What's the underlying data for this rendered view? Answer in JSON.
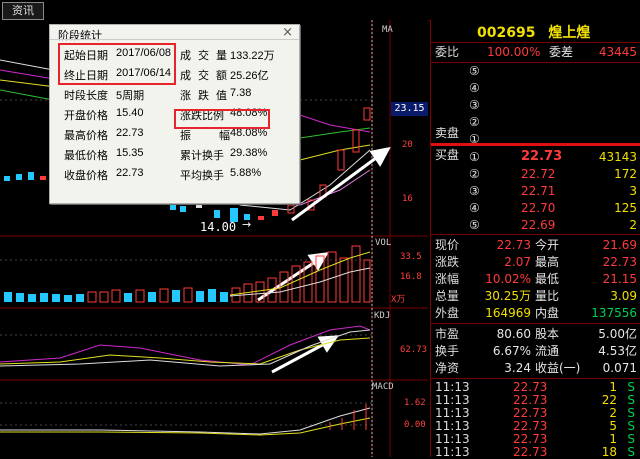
{
  "tabs": {
    "news": "资讯"
  },
  "chart": {
    "main_label": "MA",
    "price_low_annot": "14.00",
    "y_axis": [
      "20",
      "16"
    ],
    "price_tag": "23.15",
    "vol_label": "VOL",
    "vol_axis": [
      "33.5",
      "16.8"
    ],
    "vol_unit": "X万",
    "kdj_label": "KDJ",
    "kdj_axis": [
      "62.73"
    ],
    "macd_label": "MACD",
    "macd_axis": [
      "1.62",
      "0.00"
    ]
  },
  "dialog": {
    "title": "阶段统计",
    "close": "×",
    "left": [
      {
        "k": "起始日期",
        "v": "2017/06/08"
      },
      {
        "k": "终止日期",
        "v": "2017/06/14"
      },
      {
        "k": "时段长度",
        "v": "5周期"
      },
      {
        "k": "开盘价格",
        "v": "15.40"
      },
      {
        "k": "最高价格",
        "v": "22.73"
      },
      {
        "k": "最低价格",
        "v": "15.35"
      },
      {
        "k": "收盘价格",
        "v": "22.73"
      }
    ],
    "right": [
      {
        "k": "成  交  量",
        "v": "133.22万"
      },
      {
        "k": "成  交  额",
        "v": "25.26亿"
      },
      {
        "k": "涨  跌  值",
        "v": "7.38"
      },
      {
        "k": "涨跌比例",
        "v": "48.08%"
      },
      {
        "k": "振        幅",
        "v": "48.08%"
      },
      {
        "k": "累计换手",
        "v": "29.38%"
      },
      {
        "k": "平均换手",
        "v": "5.88%"
      }
    ]
  },
  "quote": {
    "code": "002695",
    "name": "煌上煌",
    "weibi_label": "委比",
    "weibi_value": "100.00%",
    "weicha_label": "委差",
    "weicha_value": "43445",
    "sell_label": "卖盘",
    "buy_label": "买盘",
    "sell_levels": [
      "⑤",
      "④",
      "③",
      "②",
      "①"
    ],
    "buy": [
      {
        "lvl": "①",
        "price": "22.73",
        "vol": "43143"
      },
      {
        "lvl": "②",
        "price": "22.72",
        "vol": "172"
      },
      {
        "lvl": "③",
        "price": "22.71",
        "vol": "3"
      },
      {
        "lvl": "④",
        "price": "22.70",
        "vol": "125"
      },
      {
        "lvl": "⑤",
        "price": "22.69",
        "vol": "2"
      }
    ],
    "stats": [
      {
        "l1": "现价",
        "v1": "22.73",
        "l2": "今开",
        "v2": "21.69"
      },
      {
        "l1": "涨跌",
        "v1": "2.07",
        "l2": "最高",
        "v2": "22.73"
      },
      {
        "l1": "涨幅",
        "v1": "10.02%",
        "l2": "最低",
        "v2": "21.15"
      },
      {
        "l1": "总量",
        "v1": "30.25万",
        "l2": "量比",
        "v2": "3.09"
      },
      {
        "l1": "外盘",
        "v1": "164969",
        "l2": "内盘",
        "v2": "137556"
      }
    ],
    "stats2": [
      {
        "l1": "市盈",
        "v1": "80.60",
        "l2": "股本",
        "v2": "5.00亿"
      },
      {
        "l1": "换手",
        "v1": "6.67%",
        "l2": "流通",
        "v2": "4.53亿"
      },
      {
        "l1": "净资",
        "v1": "3.24",
        "l2": "收益(一)",
        "v2": "0.071"
      }
    ],
    "ticks": [
      {
        "t": "11:13",
        "p": "22.73",
        "v": "1",
        "d": "S"
      },
      {
        "t": "11:13",
        "p": "22.73",
        "v": "22",
        "d": "S"
      },
      {
        "t": "11:13",
        "p": "22.73",
        "v": "2",
        "d": "S"
      },
      {
        "t": "11:13",
        "p": "22.73",
        "v": "5",
        "d": "S"
      },
      {
        "t": "11:13",
        "p": "22.73",
        "v": "1",
        "d": "S"
      },
      {
        "t": "11:13",
        "p": "22.73",
        "v": "18",
        "d": "S"
      }
    ]
  },
  "colors": {
    "up": "#ff3b3b",
    "down": "#00d050",
    "accent": "#f0e000",
    "border": "#7a0000"
  }
}
